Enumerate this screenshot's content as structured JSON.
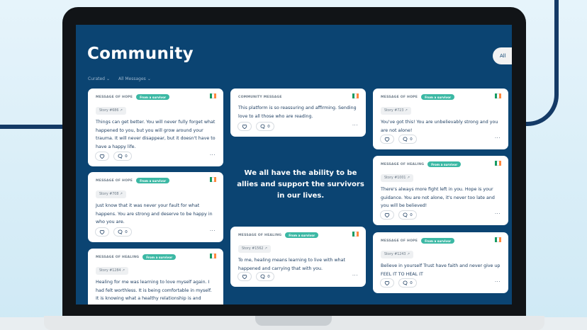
{
  "page": {
    "title": "Community"
  },
  "toolbar": {
    "all_label": "All"
  },
  "filters": {
    "curated": "Curated",
    "all_messages": "All Messages"
  },
  "featured_quote": "We all have the ability to be allies and support the survivors in our lives.",
  "colors": {
    "screen_bg": "#0b4472",
    "badge": "#3bb8a4",
    "brand_dark": "#143a66",
    "backdrop": "#cfe9f5"
  },
  "cards": [
    {
      "category": "MESSAGE OF HOPE",
      "badge": "From a survivor",
      "story": "Story #686 ↗",
      "message": "Things can get better. You will never fully forget what happened to you, but you will grow around your trauma. It will never disappear, but it doesn't have to have a happy life.",
      "comments": "0"
    },
    {
      "category": "MESSAGE OF HOPE",
      "badge": "From a survivor",
      "story": "Story #708 ↗",
      "message": "Just know that it was never your fault for what happens. You are strong and deserve to be happy in who you are.",
      "comments": "0"
    },
    {
      "category": "MESSAGE OF HEALING",
      "badge": "From a survivor",
      "story": "Story #1284 ↗",
      "message": "Healing for me was learning to love myself again. I had felt worthless. It is being comfortable in myself. It is knowing what a healthy relationship is and",
      "comments": "0"
    },
    {
      "category": "COMMUNITY MESSAGE",
      "badge": "",
      "story": "",
      "message": "This platform is so reassuring and affirming. Sending love to all those who are reading.",
      "comments": "0"
    },
    {
      "category": "MESSAGE OF HEALING",
      "badge": "From a survivor",
      "story": "Story #1562 ↗",
      "message": "To me, healing means learning to live with what happened and carrying that with you.",
      "comments": "0"
    },
    {
      "category": "MESSAGE OF HOPE",
      "badge": "From a survivor",
      "story": "Story #723 ↗",
      "message": "You've got this! You are unbelievably strong and you are not alone!",
      "comments": "0"
    },
    {
      "category": "MESSAGE OF HEALING",
      "badge": "From a survivor",
      "story": "Story #1001 ↗",
      "message": "There's always more fight left in you. Hope is your guidance. You are not alone, it's never too late and you will be believed!",
      "comments": "0"
    },
    {
      "category": "MESSAGE OF HOPE",
      "badge": "From a survivor",
      "story": "Story #1243 ↗",
      "message": "Believe in yourself Trust have faith and never give up FEEL IT TO HEAL IT",
      "comments": "0"
    }
  ]
}
